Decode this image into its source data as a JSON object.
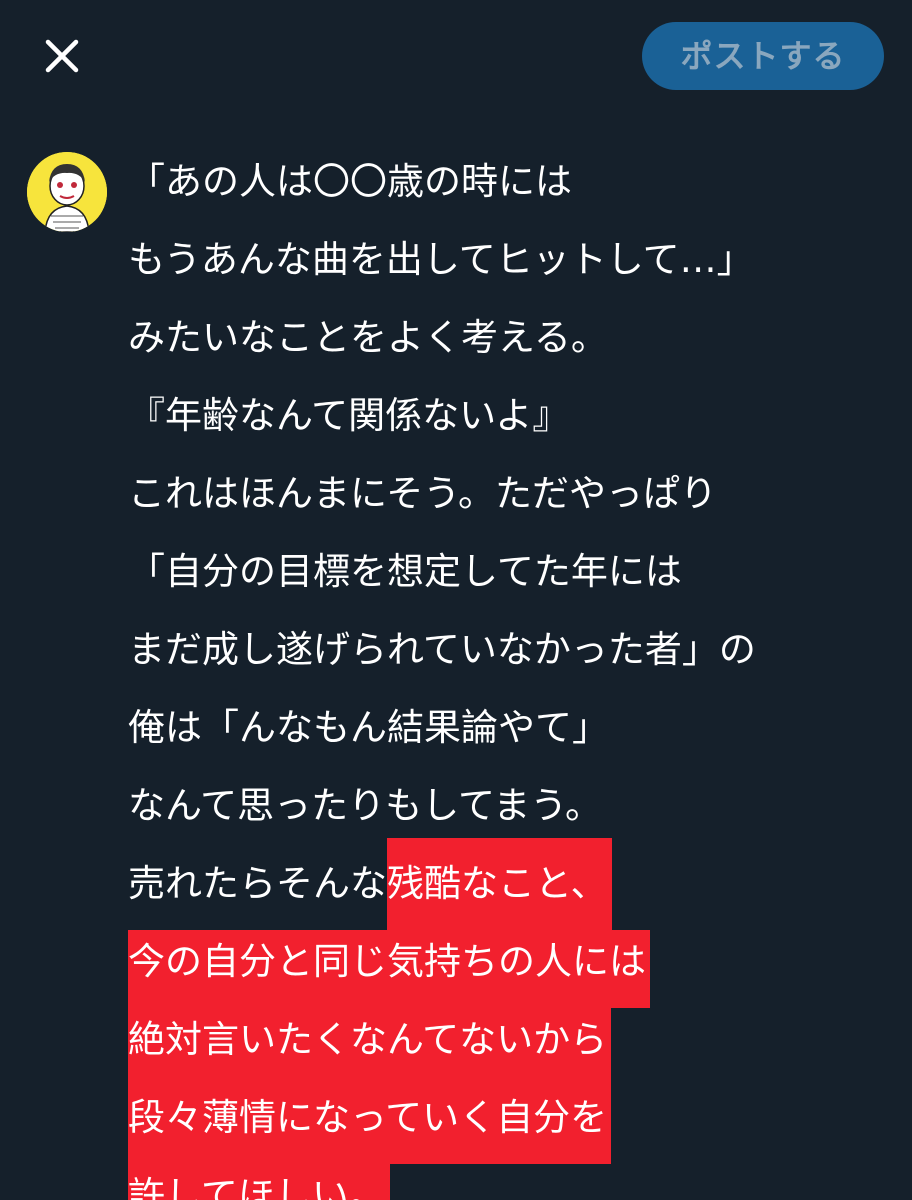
{
  "header": {
    "close_icon": "close-icon",
    "post_label": "ポストする",
    "post_button_color": "#1a6196"
  },
  "author": {
    "avatar_icon": "avatar-illustration",
    "avatar_bg": "#f7e43c"
  },
  "post": {
    "highlight_color": "#f2202e",
    "lines": [
      {
        "text": "「あの人は〇〇歳の時には"
      },
      {
        "text": "もうあんな曲を出してヒットして…」"
      },
      {
        "text": "みたいなことをよく考える。"
      },
      {
        "text": "『年齢なんて関係ないよ』"
      },
      {
        "text": "これはほんまにそう。ただやっぱり"
      },
      {
        "text": "「自分の目標を想定してた年には"
      },
      {
        "text": "まだ成し遂げられていなかった者」の"
      },
      {
        "text": "俺は「んなもん結果論やて」"
      },
      {
        "text": "なんて思ったりもしてまう。"
      },
      {
        "text": "売れたらそんな",
        "highlight": "残酷なこと、"
      },
      {
        "highlight": "今の自分と同じ気持ちの人には"
      },
      {
        "highlight": "絶対言いたくなんてないから"
      },
      {
        "highlight": "段々薄情になっていく自分を"
      },
      {
        "highlight": "許してほしい。"
      }
    ]
  }
}
